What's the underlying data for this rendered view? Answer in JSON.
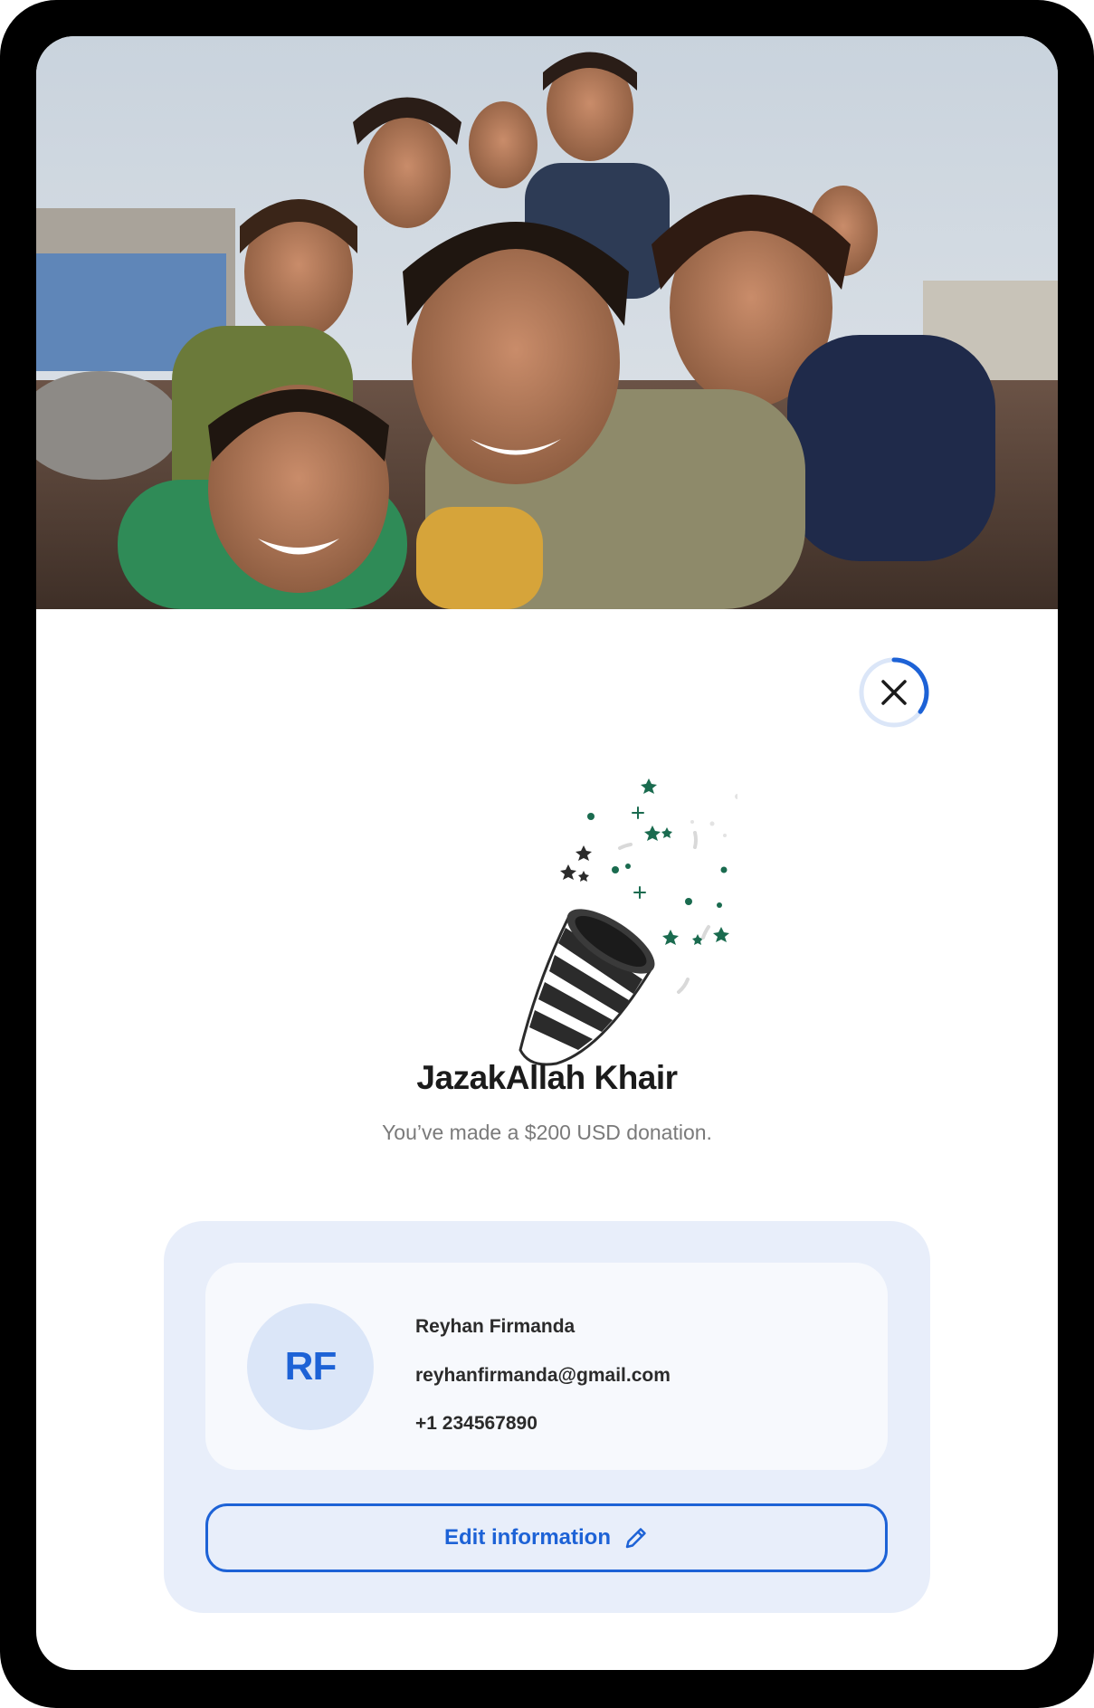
{
  "hero": {
    "alt": "Group of smiling children"
  },
  "close_button": {
    "label": "Close",
    "icon": "close-icon",
    "countdown_progress": 0.35,
    "accent": "#1d62d6"
  },
  "illustration": {
    "icon": "party-popper-icon"
  },
  "confirmation": {
    "title": "JazakAllah Khair",
    "message": "You’ve made a $200 USD donation."
  },
  "donor": {
    "initials": "RF",
    "name": "Reyhan Firmanda",
    "email": "reyhanfirmanda@gmail.com",
    "phone": "+1 234567890"
  },
  "edit_button": {
    "label": "Edit information",
    "icon": "pencil-icon"
  },
  "colors": {
    "accent": "#1d62d6",
    "panel_bg": "#e8eefa",
    "confetti_green": "#1a6b4f"
  }
}
